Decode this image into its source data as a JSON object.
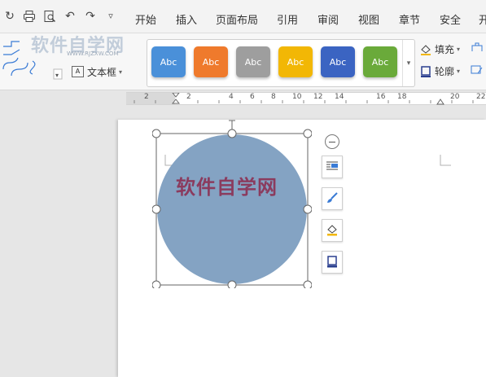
{
  "menu": {
    "tabs": [
      "开始",
      "插入",
      "页面布局",
      "引用",
      "审阅",
      "视图",
      "章节",
      "安全",
      "开"
    ]
  },
  "ribbon": {
    "watermark": "软件自学网",
    "watermark_url": "WWW.RJZXW.COM",
    "textbox_label": "文本框",
    "fill_label": "填充",
    "outline_label": "轮廓",
    "style_buttons": [
      {
        "label": "Abc",
        "color": "#4a90d9"
      },
      {
        "label": "Abc",
        "color": "#ef7a2c"
      },
      {
        "label": "Abc",
        "color": "#9e9e9e"
      },
      {
        "label": "Abc",
        "color": "#f2b705"
      },
      {
        "label": "Abc",
        "color": "#3b64c2"
      },
      {
        "label": "Abc",
        "color": "#6aaa3a"
      }
    ]
  },
  "ruler": {
    "numbers": [
      "2",
      "2",
      "4",
      "6",
      "8",
      "10",
      "12",
      "14",
      "16",
      "18",
      "20",
      "22"
    ]
  },
  "document": {
    "shape_text": "软件自学网",
    "shape_fill": "#84a3c3",
    "shape_text_color": "#8b3b5e"
  }
}
